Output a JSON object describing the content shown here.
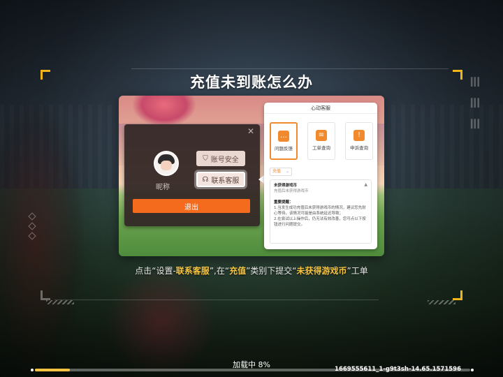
{
  "title": "充值未到账怎么办",
  "dialog": {
    "nickname": "昵称",
    "security_button": "账号安全",
    "service_button": "联系客服",
    "exit_button": "退出",
    "close_glyph": "✕"
  },
  "cs_panel": {
    "header": "心动客服",
    "tiles": [
      {
        "label": "问题反馈",
        "icon": "chat-icon"
      },
      {
        "label": "工单查询",
        "icon": "document-icon"
      },
      {
        "label": "申诉查询",
        "icon": "shield-icon"
      }
    ],
    "category": "充值",
    "issue_title": "未获得游戏币",
    "issue_subtitle": "充值后未获得游戏币",
    "notice_heading": "重要提醒：",
    "notice_lines": [
      "1.当发生成功充值后未获得游戏币的情况，建议您先耐心等待，该情况可能是由系统延迟导致；",
      "2.在尝试以上操作后，仍无法有效改善，您可点以下按钮进行问题提交。"
    ]
  },
  "instruction": {
    "p1": "点击“设置-",
    "h1": "联系客服",
    "p2": "”,在“",
    "h2": "充值",
    "p3": "”类别下提交“",
    "h3": "未获得游戏币",
    "p4": "”工单"
  },
  "loading": {
    "label": "加载中 8%",
    "progress": 0.08
  },
  "version": "1669555611_1-g9t3sh-14.65.1571596",
  "colors": {
    "accent": "#f5c342",
    "exit_button": "#f46b1d",
    "cs_icon": "#f08a2c"
  }
}
